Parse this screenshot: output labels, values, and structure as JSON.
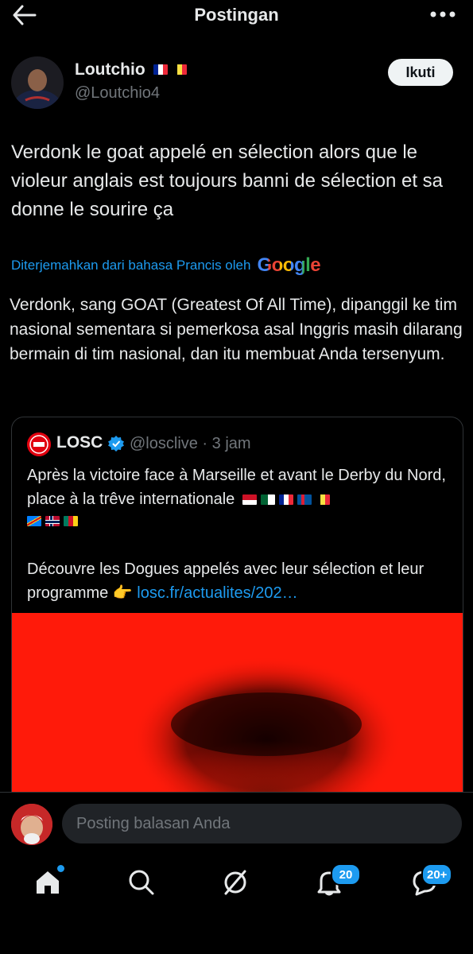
{
  "header": {
    "title": "Postingan"
  },
  "author": {
    "display_name": "Loutchio",
    "handle": "@Loutchio4",
    "follow_label": "Ikuti",
    "flags": [
      "france-flag",
      "belgium-flag"
    ]
  },
  "post": {
    "text": "Verdonk le goat appelé en sélection alors que le violeur anglais est toujours banni de sélection et sa donne le sourire ça",
    "translated_note": "Diterjemahkan dari bahasa Prancis oleh",
    "translator_brand": "Google",
    "translation": "Verdonk, sang GOAT (Greatest Of All Time), dipanggil ke tim nasional sementara si pemerkosa asal Inggris masih dilarang bermain di tim nasional, dan itu membuat Anda tersenyum."
  },
  "quote": {
    "name": "LOSC",
    "handle_time": "@losclive · 3 jam",
    "text1": "Après la victoire face à Marseille et avant le Derby du Nord, place à la trêve internationale",
    "flags_line1": [
      "indonesia-flag",
      "algeria-flag",
      "france-flag",
      "iceland-flag",
      "belgium-flag"
    ],
    "flags_line2": [
      "dr-congo-flag",
      "norway-flag",
      "cameroon-flag"
    ],
    "text2": "Découvre les Dogues appelés avec leur sélection et leur programme 👉",
    "link": "losc.fr/actualites/202…"
  },
  "reply": {
    "placeholder": "Posting balasan Anda"
  },
  "nav": {
    "notifications_badge": "20",
    "messages_badge": "20+"
  },
  "colors": {
    "accent": "#1d9bf0",
    "background": "#000000",
    "media_red": "#ff1a0a"
  }
}
